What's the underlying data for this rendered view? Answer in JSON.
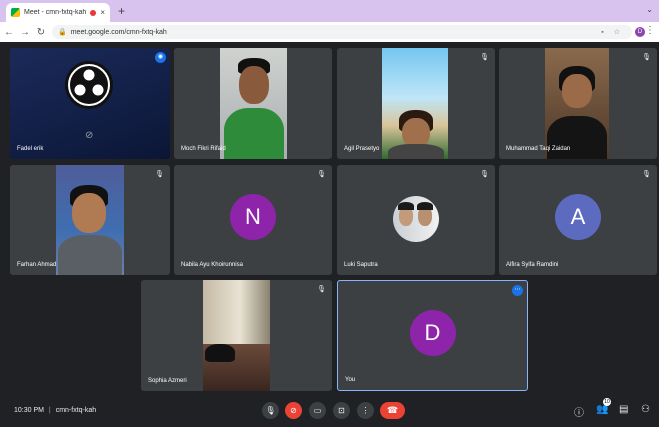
{
  "browser": {
    "tab_title": "Meet - cmn-fxtq-kah",
    "tab_close": "×",
    "new_tab": "+",
    "window_control": "⌄",
    "url": "meet.google.com/cmn-fxtq-kah",
    "profile_initial": "D"
  },
  "participants": [
    {
      "name": "Fadel erik",
      "type": "obs"
    },
    {
      "name": "Moch Fikri Rifaid",
      "type": "video"
    },
    {
      "name": "Agil Prasetyo",
      "type": "video"
    },
    {
      "name": "Muhammad Taqi Zaidan",
      "type": "video"
    },
    {
      "name": "Farhan Ahmad",
      "type": "video"
    },
    {
      "name": "Nabila Ayu Khoirunnisa",
      "type": "avatar",
      "initial": "N",
      "color": "#8e24aa"
    },
    {
      "name": "Luki Saputra",
      "type": "photo"
    },
    {
      "name": "Alfira Syifa Ramdini",
      "type": "avatar",
      "initial": "A",
      "color": "#5c6bc0"
    },
    {
      "name": "Sophia Azmeri",
      "type": "video"
    },
    {
      "name": "You",
      "type": "avatar",
      "initial": "D",
      "color": "#8e24aa"
    }
  ],
  "meeting": {
    "time": "10:30 PM",
    "separator": "|",
    "code": "cmn-fxtq-kah",
    "people_count": "10"
  },
  "colors": {
    "meet_bg": "#202124",
    "tile_bg": "#3c4043",
    "leave_red": "#ea4335",
    "active_blue": "#8ab4f8",
    "tab_strip": "#d8c2ee"
  }
}
